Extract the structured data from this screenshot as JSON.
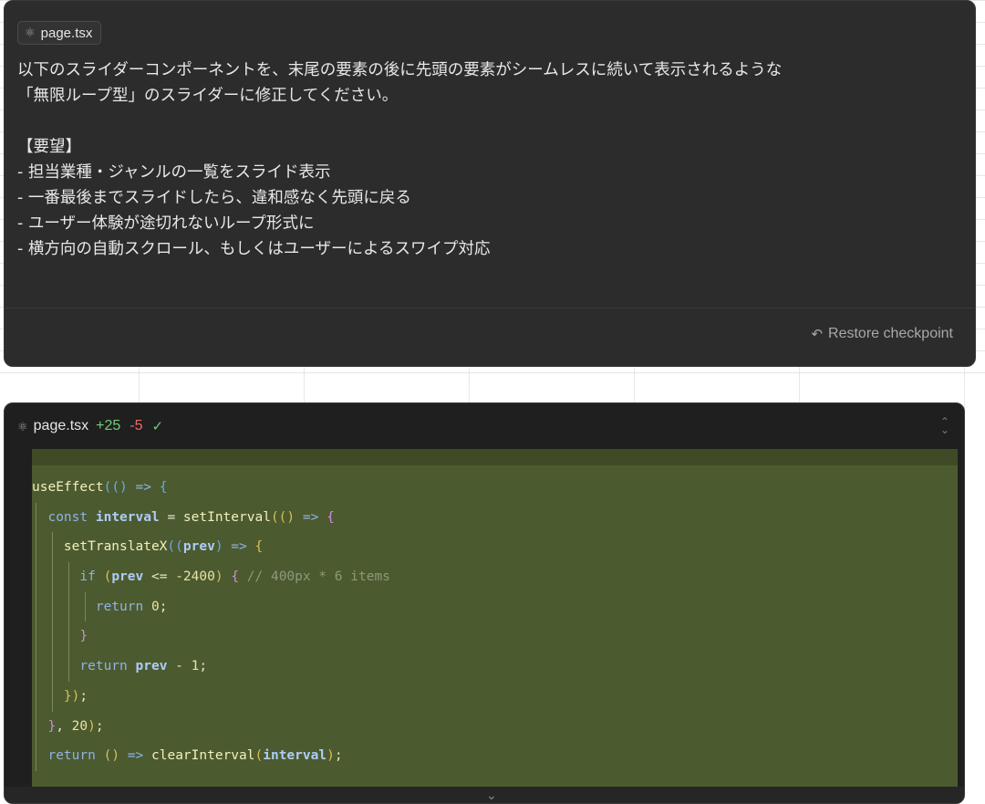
{
  "message": {
    "file_chip": {
      "label": "page.tsx",
      "icon": "react-icon"
    },
    "lines": [
      "以下のスライダーコンポーネントを、末尾の要素の後に先頭の要素がシームレスに続いて表示されるような",
      "「無限ループ型」のスライダーに修正してください。",
      "",
      "【要望】",
      "- 担当業種・ジャンルの一覧をスライド表示",
      "- 一番最後までスライドしたら、違和感なく先頭に戻る",
      "- ユーザー体験が途切れないループ形式に",
      "- 横方向の自動スクロール、もしくはユーザーによるスワイプ対応"
    ],
    "restore_label": "Restore checkpoint",
    "restore_icon": "undo-icon"
  },
  "code": {
    "header": {
      "filename": "page.tsx",
      "added": "+25",
      "removed": "-5",
      "status_icon": "check-icon"
    },
    "lines": [
      "useEffect(() => {",
      "  const interval = setInterval(() => {",
      "    setTranslateX((prev) => {",
      "      if (prev <= -2400) { // 400px * 6 items",
      "        return 0;",
      "      }",
      "      return prev - 1;",
      "    });",
      "  }, 20);",
      "  return () => clearInterval(interval);",
      "}, []);"
    ],
    "colors": {
      "added_bg": "#4c5a2f",
      "panel_bg": "#1f1f1f",
      "added_count": "#6fcf73",
      "removed_count": "#f06a6a"
    }
  }
}
